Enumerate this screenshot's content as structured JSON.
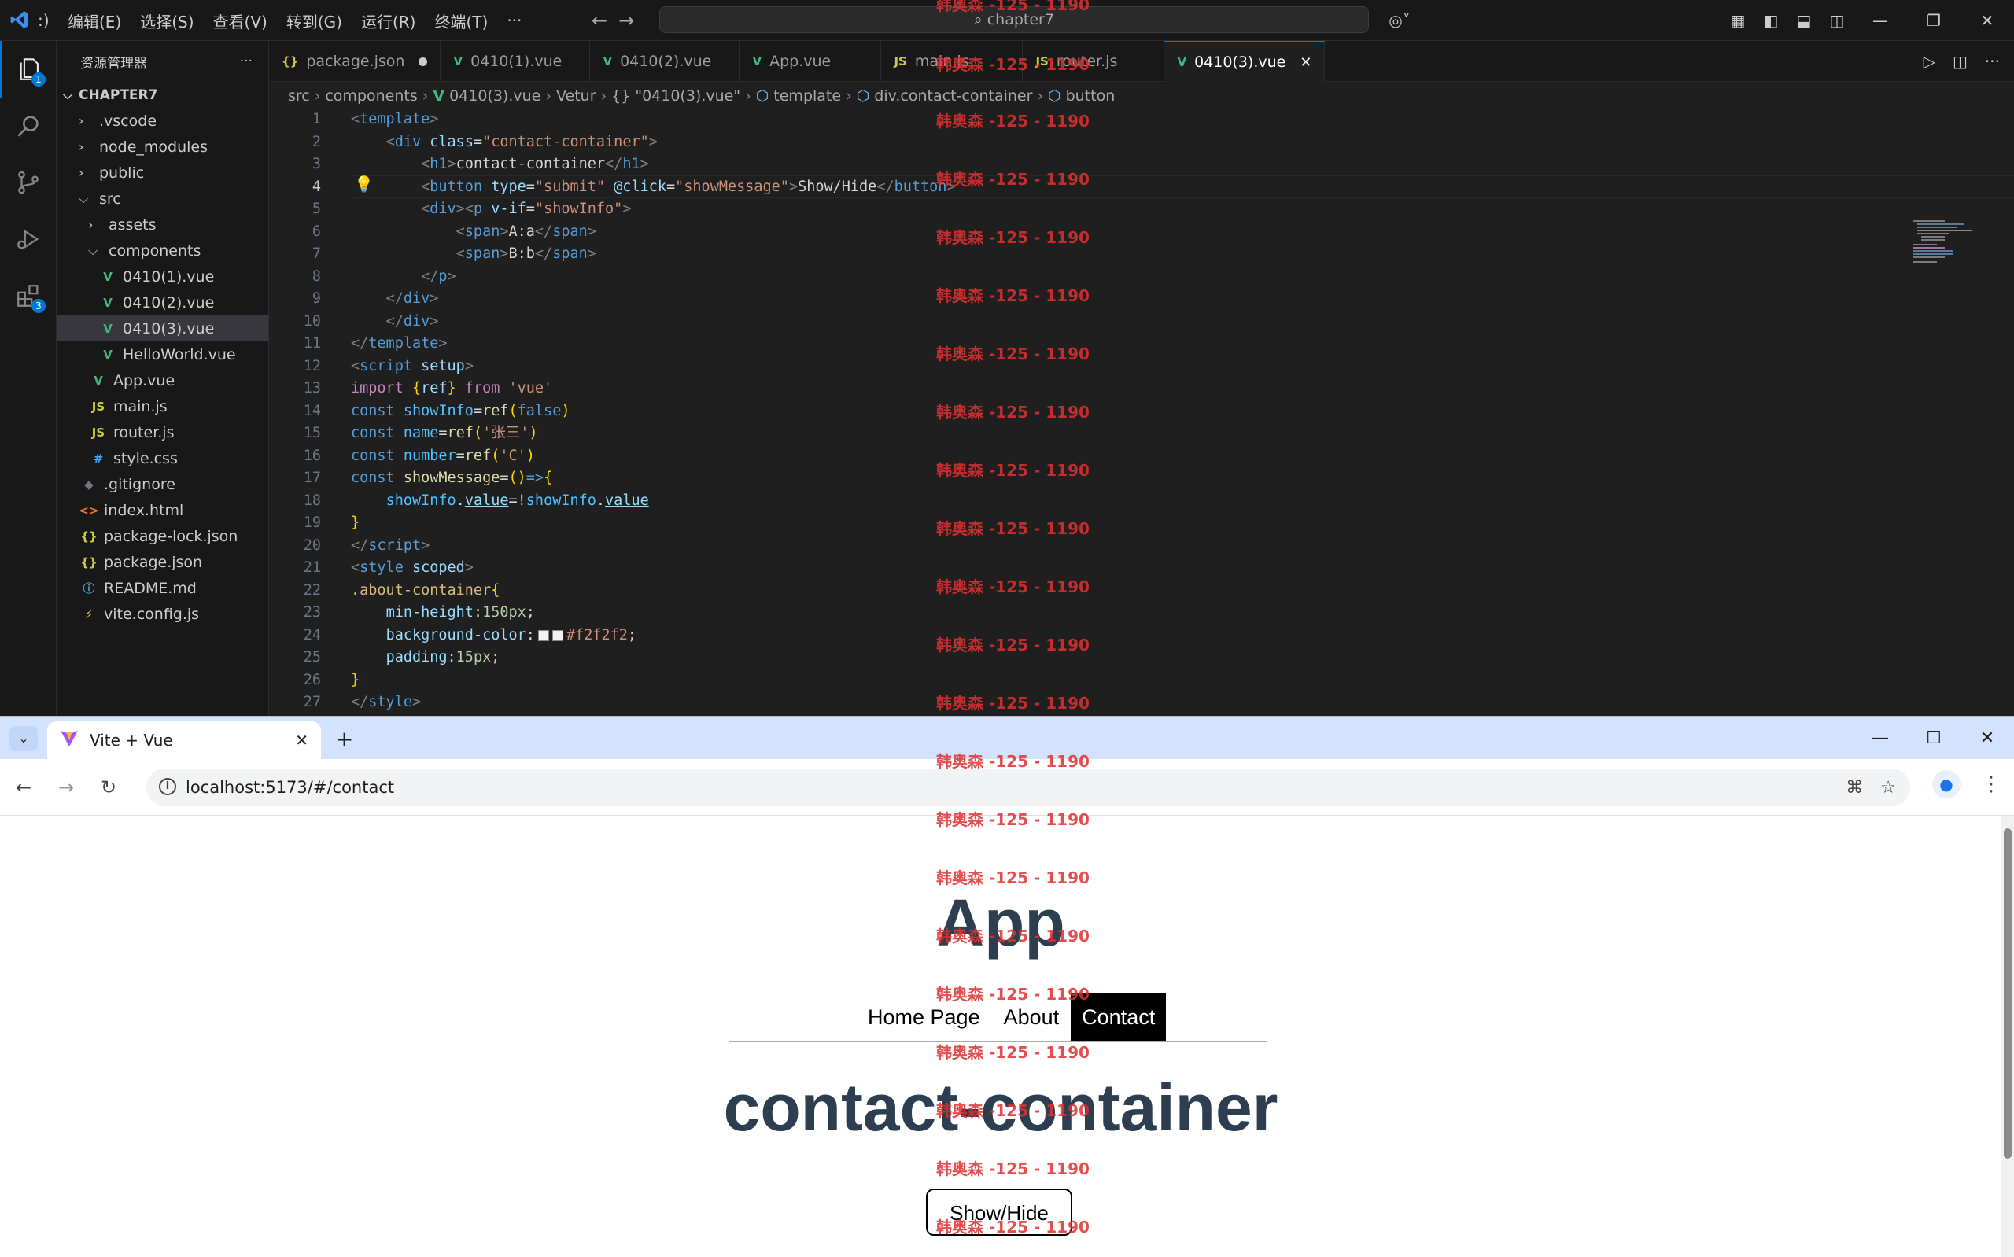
{
  "vscode": {
    "menu": [
      "编辑(E)",
      "选择(S)",
      "查看(V)",
      "转到(G)",
      "运行(R)",
      "终端(T)",
      "···"
    ],
    "command_center": "chapter7",
    "explorer": {
      "title": "资源管理器",
      "root": "CHAPTER7",
      "items": [
        {
          "label": ".vscode",
          "type": "folder",
          "indent": 1
        },
        {
          "label": "node_modules",
          "type": "folder",
          "indent": 1
        },
        {
          "label": "public",
          "type": "folder",
          "indent": 1
        },
        {
          "label": "src",
          "type": "folder-open",
          "indent": 1
        },
        {
          "label": "assets",
          "type": "folder",
          "indent": 2
        },
        {
          "label": "components",
          "type": "folder-open",
          "indent": 2
        },
        {
          "label": "0410(1).vue",
          "type": "vue",
          "indent": 3
        },
        {
          "label": "0410(2).vue",
          "type": "vue",
          "indent": 3
        },
        {
          "label": "0410(3).vue",
          "type": "vue",
          "indent": 3,
          "selected": true
        },
        {
          "label": "HelloWorld.vue",
          "type": "vue",
          "indent": 3
        },
        {
          "label": "App.vue",
          "type": "vue",
          "indent": 2
        },
        {
          "label": "main.js",
          "type": "js",
          "indent": 2
        },
        {
          "label": "router.js",
          "type": "js",
          "indent": 2
        },
        {
          "label": "style.css",
          "type": "css",
          "indent": 2
        },
        {
          "label": ".gitignore",
          "type": "git",
          "indent": 1
        },
        {
          "label": "index.html",
          "type": "html",
          "indent": 1
        },
        {
          "label": "package-lock.json",
          "type": "json",
          "indent": 1
        },
        {
          "label": "package.json",
          "type": "json",
          "indent": 1
        },
        {
          "label": "README.md",
          "type": "info",
          "indent": 1
        },
        {
          "label": "vite.config.js",
          "type": "vite",
          "indent": 1
        }
      ]
    },
    "tabs": [
      {
        "label": "package.json",
        "icon": "{}",
        "type": "json",
        "dirty": true
      },
      {
        "label": "0410(1).vue",
        "icon": "V",
        "type": "vue"
      },
      {
        "label": "0410(2).vue",
        "icon": "V",
        "type": "vue"
      },
      {
        "label": "App.vue",
        "icon": "V",
        "type": "vue"
      },
      {
        "label": "main.js",
        "icon": "JS",
        "type": "js"
      },
      {
        "label": "router.js",
        "icon": "JS",
        "type": "js"
      },
      {
        "label": "0410(3).vue",
        "icon": "V",
        "type": "vue",
        "active": true
      }
    ],
    "breadcrumb": [
      "src",
      "components",
      "0410(3).vue",
      "Vetur",
      "{} \"0410(3).vue\"",
      "template",
      "div.contact-container",
      "button"
    ],
    "badges": {
      "explorer": "1",
      "extensions": "3"
    },
    "line_numbers": [
      "1",
      "2",
      "3",
      "4",
      "5",
      "6",
      "7",
      "8",
      "9",
      "10",
      "11",
      "12",
      "13",
      "14",
      "15",
      "16",
      "17",
      "18",
      "19",
      "20",
      "21",
      "22",
      "23",
      "24",
      "25",
      "26",
      "27"
    ],
    "current_line": "4",
    "code": [
      [
        [
          "t",
          "<"
        ],
        [
          "tg",
          "template"
        ],
        [
          "t",
          ">"
        ]
      ],
      [
        [
          "tx",
          "    "
        ],
        [
          "t",
          "<"
        ],
        [
          "tg",
          "div "
        ],
        [
          "at",
          "class"
        ],
        [
          "tx",
          "="
        ],
        [
          "st",
          "\"contact-container\""
        ],
        [
          "t",
          ">"
        ]
      ],
      [
        [
          "tx",
          "        "
        ],
        [
          "t",
          "<"
        ],
        [
          "tg",
          "h1"
        ],
        [
          "t",
          ">"
        ],
        [
          "tx",
          "contact-container"
        ],
        [
          "t",
          "</"
        ],
        [
          "tg",
          "h1"
        ],
        [
          "t",
          ">"
        ]
      ],
      [
        [
          "tx",
          "        "
        ],
        [
          "t",
          "<"
        ],
        [
          "tg",
          "button "
        ],
        [
          "at",
          "type"
        ],
        [
          "tx",
          "="
        ],
        [
          "st",
          "\"submit\" "
        ],
        [
          "at",
          "@click"
        ],
        [
          "tx",
          "="
        ],
        [
          "st",
          "\"showMessage\""
        ],
        [
          "t",
          ">"
        ],
        [
          "tx",
          "Show/Hide"
        ],
        [
          "t",
          "</"
        ],
        [
          "tg",
          "button"
        ],
        [
          "t",
          ">"
        ]
      ],
      [
        [
          "tx",
          "        "
        ],
        [
          "t",
          "<"
        ],
        [
          "tg",
          "div"
        ],
        [
          "t",
          "><"
        ],
        [
          "tg",
          "p "
        ],
        [
          "at",
          "v-if"
        ],
        [
          "tx",
          "="
        ],
        [
          "st",
          "\"showInfo\""
        ],
        [
          "t",
          ">"
        ]
      ],
      [
        [
          "tx",
          "            "
        ],
        [
          "t",
          "<"
        ],
        [
          "tg",
          "span"
        ],
        [
          "t",
          ">"
        ],
        [
          "tx",
          "A:a"
        ],
        [
          "t",
          "</"
        ],
        [
          "tg",
          "span"
        ],
        [
          "t",
          ">"
        ]
      ],
      [
        [
          "tx",
          "            "
        ],
        [
          "t",
          "<"
        ],
        [
          "tg",
          "span"
        ],
        [
          "t",
          ">"
        ],
        [
          "tx",
          "B:b"
        ],
        [
          "t",
          "</"
        ],
        [
          "tg",
          "span"
        ],
        [
          "t",
          ">"
        ]
      ],
      [
        [
          "tx",
          "        "
        ],
        [
          "t",
          "</"
        ],
        [
          "tg",
          "p"
        ],
        [
          "t",
          ">"
        ]
      ],
      [
        [
          "tx",
          "    "
        ],
        [
          "t",
          "</"
        ],
        [
          "tg",
          "div"
        ],
        [
          "t",
          ">"
        ]
      ],
      [
        [
          "tx",
          "    "
        ],
        [
          "t",
          "</"
        ],
        [
          "tg",
          "div"
        ],
        [
          "t",
          ">"
        ]
      ],
      [
        [
          "t",
          "</"
        ],
        [
          "tg",
          "template"
        ],
        [
          "t",
          ">"
        ]
      ],
      [
        [
          "t",
          "<"
        ],
        [
          "tg",
          "script "
        ],
        [
          "at",
          "setup"
        ],
        [
          "t",
          ">"
        ]
      ],
      [
        [
          "kw",
          "import "
        ],
        [
          "pu",
          "{"
        ],
        [
          "at",
          "ref"
        ],
        [
          "pu",
          "}"
        ],
        [
          "kw",
          " from "
        ],
        [
          "st",
          "'vue'"
        ]
      ],
      [
        [
          "kb",
          "const "
        ],
        [
          "var",
          "showInfo"
        ],
        [
          "tx",
          "="
        ],
        [
          "fn",
          "ref"
        ],
        [
          "pu",
          "("
        ],
        [
          "kb",
          "false"
        ],
        [
          "pu",
          ")"
        ]
      ],
      [
        [
          "kb",
          "const "
        ],
        [
          "var",
          "name"
        ],
        [
          "tx",
          "="
        ],
        [
          "fn",
          "ref"
        ],
        [
          "pu",
          "("
        ],
        [
          "st",
          "'张三'"
        ],
        [
          "pu",
          ")"
        ]
      ],
      [
        [
          "kb",
          "const "
        ],
        [
          "var",
          "number"
        ],
        [
          "tx",
          "="
        ],
        [
          "fn",
          "ref"
        ],
        [
          "pu",
          "("
        ],
        [
          "st",
          "'C'"
        ],
        [
          "pu",
          ")"
        ]
      ],
      [
        [
          "kb",
          "const "
        ],
        [
          "fn",
          "showMessage"
        ],
        [
          "tx",
          "="
        ],
        [
          "pu",
          "()"
        ],
        [
          "kb",
          "=>"
        ],
        [
          "pu",
          "{"
        ]
      ],
      [
        [
          "tx",
          "    "
        ],
        [
          "var",
          "showInfo"
        ],
        [
          "tx",
          "."
        ],
        [
          "at",
          "value"
        ],
        [
          "tx",
          "=!"
        ],
        [
          "var",
          "showInfo"
        ],
        [
          "tx",
          "."
        ],
        [
          "at",
          "value"
        ]
      ],
      [
        [
          "pu",
          "}"
        ]
      ],
      [
        [
          "t",
          "</"
        ],
        [
          "tg",
          "script"
        ],
        [
          "t",
          ">"
        ]
      ],
      [
        [
          "t",
          "<"
        ],
        [
          "tg",
          "style "
        ],
        [
          "at",
          "scoped"
        ],
        [
          "t",
          ">"
        ]
      ],
      [
        [
          "cl",
          ".about-container"
        ],
        [
          "pu",
          "{"
        ]
      ],
      [
        [
          "tx",
          "    "
        ],
        [
          "at",
          "min-height"
        ],
        [
          "tx",
          ":"
        ],
        [
          "nm",
          "150px"
        ],
        [
          "tx",
          ";"
        ]
      ],
      [
        [
          "tx",
          "    "
        ],
        [
          "at",
          "background-color"
        ],
        [
          "tx",
          ":"
        ],
        [
          "sw",
          ""
        ],
        [
          "st",
          "#f2f2f2"
        ],
        [
          "tx",
          ";"
        ]
      ],
      [
        [
          "tx",
          "    "
        ],
        [
          "at",
          "padding"
        ],
        [
          "tx",
          ":"
        ],
        [
          "nm",
          "15px"
        ],
        [
          "tx",
          ";"
        ]
      ],
      [
        [
          "pu",
          "}"
        ]
      ],
      [
        [
          "t",
          "</"
        ],
        [
          "tg",
          "style"
        ],
        [
          "t",
          ">"
        ]
      ]
    ]
  },
  "watermark": "韩奥森 -125 - 1190",
  "browser": {
    "tab_title": "Vite + Vue",
    "url": "localhost:5173/#/contact",
    "page": {
      "title": "App",
      "nav": [
        "Home Page",
        "About",
        "Contact"
      ],
      "active_nav": "Contact",
      "heading": "contact-container",
      "button": "Show/Hide"
    }
  },
  "colors": {
    "accent": "#0078d4",
    "heading": "#2c3e50",
    "vue": "#41b883"
  }
}
